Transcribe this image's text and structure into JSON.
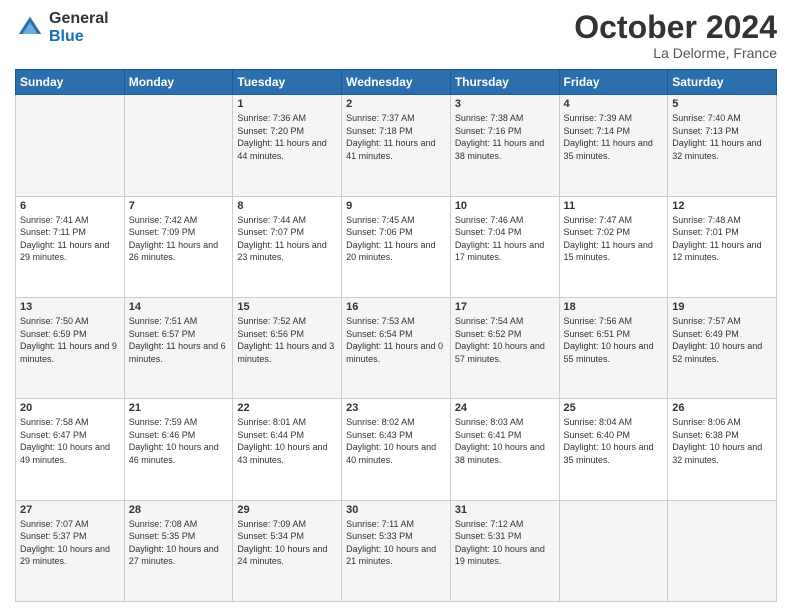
{
  "logo": {
    "general": "General",
    "blue": "Blue"
  },
  "title": "October 2024",
  "location": "La Delorme, France",
  "header_days": [
    "Sunday",
    "Monday",
    "Tuesday",
    "Wednesday",
    "Thursday",
    "Friday",
    "Saturday"
  ],
  "weeks": [
    [
      {
        "day": "",
        "sunrise": "",
        "sunset": "",
        "daylight": ""
      },
      {
        "day": "",
        "sunrise": "",
        "sunset": "",
        "daylight": ""
      },
      {
        "day": "1",
        "sunrise": "Sunrise: 7:36 AM",
        "sunset": "Sunset: 7:20 PM",
        "daylight": "Daylight: 11 hours and 44 minutes."
      },
      {
        "day": "2",
        "sunrise": "Sunrise: 7:37 AM",
        "sunset": "Sunset: 7:18 PM",
        "daylight": "Daylight: 11 hours and 41 minutes."
      },
      {
        "day": "3",
        "sunrise": "Sunrise: 7:38 AM",
        "sunset": "Sunset: 7:16 PM",
        "daylight": "Daylight: 11 hours and 38 minutes."
      },
      {
        "day": "4",
        "sunrise": "Sunrise: 7:39 AM",
        "sunset": "Sunset: 7:14 PM",
        "daylight": "Daylight: 11 hours and 35 minutes."
      },
      {
        "day": "5",
        "sunrise": "Sunrise: 7:40 AM",
        "sunset": "Sunset: 7:13 PM",
        "daylight": "Daylight: 11 hours and 32 minutes."
      }
    ],
    [
      {
        "day": "6",
        "sunrise": "Sunrise: 7:41 AM",
        "sunset": "Sunset: 7:11 PM",
        "daylight": "Daylight: 11 hours and 29 minutes."
      },
      {
        "day": "7",
        "sunrise": "Sunrise: 7:42 AM",
        "sunset": "Sunset: 7:09 PM",
        "daylight": "Daylight: 11 hours and 26 minutes."
      },
      {
        "day": "8",
        "sunrise": "Sunrise: 7:44 AM",
        "sunset": "Sunset: 7:07 PM",
        "daylight": "Daylight: 11 hours and 23 minutes."
      },
      {
        "day": "9",
        "sunrise": "Sunrise: 7:45 AM",
        "sunset": "Sunset: 7:06 PM",
        "daylight": "Daylight: 11 hours and 20 minutes."
      },
      {
        "day": "10",
        "sunrise": "Sunrise: 7:46 AM",
        "sunset": "Sunset: 7:04 PM",
        "daylight": "Daylight: 11 hours and 17 minutes."
      },
      {
        "day": "11",
        "sunrise": "Sunrise: 7:47 AM",
        "sunset": "Sunset: 7:02 PM",
        "daylight": "Daylight: 11 hours and 15 minutes."
      },
      {
        "day": "12",
        "sunrise": "Sunrise: 7:48 AM",
        "sunset": "Sunset: 7:01 PM",
        "daylight": "Daylight: 11 hours and 12 minutes."
      }
    ],
    [
      {
        "day": "13",
        "sunrise": "Sunrise: 7:50 AM",
        "sunset": "Sunset: 6:59 PM",
        "daylight": "Daylight: 11 hours and 9 minutes."
      },
      {
        "day": "14",
        "sunrise": "Sunrise: 7:51 AM",
        "sunset": "Sunset: 6:57 PM",
        "daylight": "Daylight: 11 hours and 6 minutes."
      },
      {
        "day": "15",
        "sunrise": "Sunrise: 7:52 AM",
        "sunset": "Sunset: 6:56 PM",
        "daylight": "Daylight: 11 hours and 3 minutes."
      },
      {
        "day": "16",
        "sunrise": "Sunrise: 7:53 AM",
        "sunset": "Sunset: 6:54 PM",
        "daylight": "Daylight: 11 hours and 0 minutes."
      },
      {
        "day": "17",
        "sunrise": "Sunrise: 7:54 AM",
        "sunset": "Sunset: 6:52 PM",
        "daylight": "Daylight: 10 hours and 57 minutes."
      },
      {
        "day": "18",
        "sunrise": "Sunrise: 7:56 AM",
        "sunset": "Sunset: 6:51 PM",
        "daylight": "Daylight: 10 hours and 55 minutes."
      },
      {
        "day": "19",
        "sunrise": "Sunrise: 7:57 AM",
        "sunset": "Sunset: 6:49 PM",
        "daylight": "Daylight: 10 hours and 52 minutes."
      }
    ],
    [
      {
        "day": "20",
        "sunrise": "Sunrise: 7:58 AM",
        "sunset": "Sunset: 6:47 PM",
        "daylight": "Daylight: 10 hours and 49 minutes."
      },
      {
        "day": "21",
        "sunrise": "Sunrise: 7:59 AM",
        "sunset": "Sunset: 6:46 PM",
        "daylight": "Daylight: 10 hours and 46 minutes."
      },
      {
        "day": "22",
        "sunrise": "Sunrise: 8:01 AM",
        "sunset": "Sunset: 6:44 PM",
        "daylight": "Daylight: 10 hours and 43 minutes."
      },
      {
        "day": "23",
        "sunrise": "Sunrise: 8:02 AM",
        "sunset": "Sunset: 6:43 PM",
        "daylight": "Daylight: 10 hours and 40 minutes."
      },
      {
        "day": "24",
        "sunrise": "Sunrise: 8:03 AM",
        "sunset": "Sunset: 6:41 PM",
        "daylight": "Daylight: 10 hours and 38 minutes."
      },
      {
        "day": "25",
        "sunrise": "Sunrise: 8:04 AM",
        "sunset": "Sunset: 6:40 PM",
        "daylight": "Daylight: 10 hours and 35 minutes."
      },
      {
        "day": "26",
        "sunrise": "Sunrise: 8:06 AM",
        "sunset": "Sunset: 6:38 PM",
        "daylight": "Daylight: 10 hours and 32 minutes."
      }
    ],
    [
      {
        "day": "27",
        "sunrise": "Sunrise: 7:07 AM",
        "sunset": "Sunset: 5:37 PM",
        "daylight": "Daylight: 10 hours and 29 minutes."
      },
      {
        "day": "28",
        "sunrise": "Sunrise: 7:08 AM",
        "sunset": "Sunset: 5:35 PM",
        "daylight": "Daylight: 10 hours and 27 minutes."
      },
      {
        "day": "29",
        "sunrise": "Sunrise: 7:09 AM",
        "sunset": "Sunset: 5:34 PM",
        "daylight": "Daylight: 10 hours and 24 minutes."
      },
      {
        "day": "30",
        "sunrise": "Sunrise: 7:11 AM",
        "sunset": "Sunset: 5:33 PM",
        "daylight": "Daylight: 10 hours and 21 minutes."
      },
      {
        "day": "31",
        "sunrise": "Sunrise: 7:12 AM",
        "sunset": "Sunset: 5:31 PM",
        "daylight": "Daylight: 10 hours and 19 minutes."
      },
      {
        "day": "",
        "sunrise": "",
        "sunset": "",
        "daylight": ""
      },
      {
        "day": "",
        "sunrise": "",
        "sunset": "",
        "daylight": ""
      }
    ]
  ]
}
